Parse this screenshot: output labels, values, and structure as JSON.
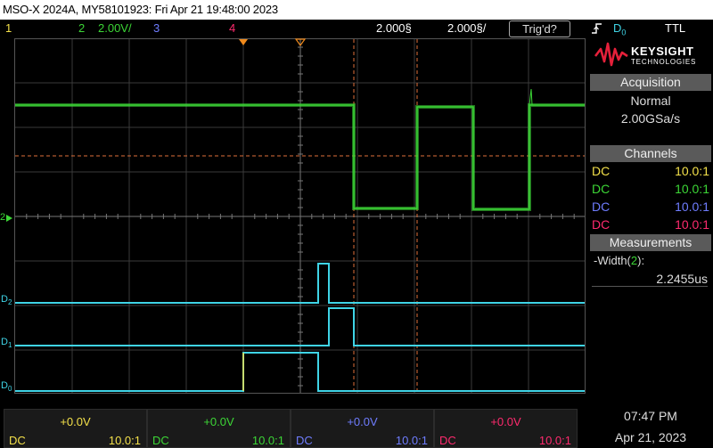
{
  "title": "MSO-X 2024A, MY58101923: Fri Apr 21 19:48:00 2023",
  "top_strip": {
    "ch1_num": "1",
    "ch2_num": "2",
    "ch2_scale": "2.00V/",
    "ch3_num": "3",
    "ch4_num": "4",
    "delay": "2.000§",
    "timebase": "2.000§/",
    "trigger_status": "Trig'd?",
    "trigger_source": "D",
    "trigger_source_sub": "0",
    "trigger_level": "TTL"
  },
  "logo": {
    "name": "KEYSIGHT",
    "sub": "TECHNOLOGIES"
  },
  "acquisition": {
    "header": "Acquisition",
    "mode": "Normal",
    "rate": "2.00GSa/s"
  },
  "channels": {
    "header": "Channels",
    "rows": [
      {
        "coupling": "DC",
        "probe": "10.0:1",
        "color": "#f3e04a"
      },
      {
        "coupling": "DC",
        "probe": "10.0:1",
        "color": "#3cd636"
      },
      {
        "coupling": "DC",
        "probe": "10.0:1",
        "color": "#6f7dff"
      },
      {
        "coupling": "DC",
        "probe": "10.0:1",
        "color": "#ff2a6e"
      }
    ]
  },
  "measurements": {
    "header": "Measurements",
    "label": "-Width(2):",
    "value": "2.2455us"
  },
  "bottom_channels": [
    {
      "offset": "+0.0V",
      "coupling": "DC",
      "probe": "10.0:1",
      "color": "#f3e04a"
    },
    {
      "offset": "+0.0V",
      "coupling": "DC",
      "probe": "10.0:1",
      "color": "#3cd636"
    },
    {
      "offset": "+0.0V",
      "coupling": "DC",
      "probe": "10.0:1",
      "color": "#6f7dff"
    },
    {
      "offset": "+0.0V",
      "coupling": "DC",
      "probe": "10.0:1",
      "color": "#ff2a6e"
    }
  ],
  "clock": {
    "time": "07:47 PM",
    "date": "Apr 21, 2023"
  },
  "digital_labels": {
    "d2": "D",
    "d2_sub": "2",
    "d1": "D",
    "d1_sub": "1",
    "d0": "D",
    "d0_sub": "0",
    "ch2_marker": "2"
  },
  "colors": {
    "ch1": "#f3e04a",
    "ch2": "#3cd636",
    "ch3": "#6f7dff",
    "ch4": "#ff2a6e",
    "digital": "#3fd4e6",
    "cursor": "#e0703a",
    "trigger_marker": "#f08a1c"
  }
}
